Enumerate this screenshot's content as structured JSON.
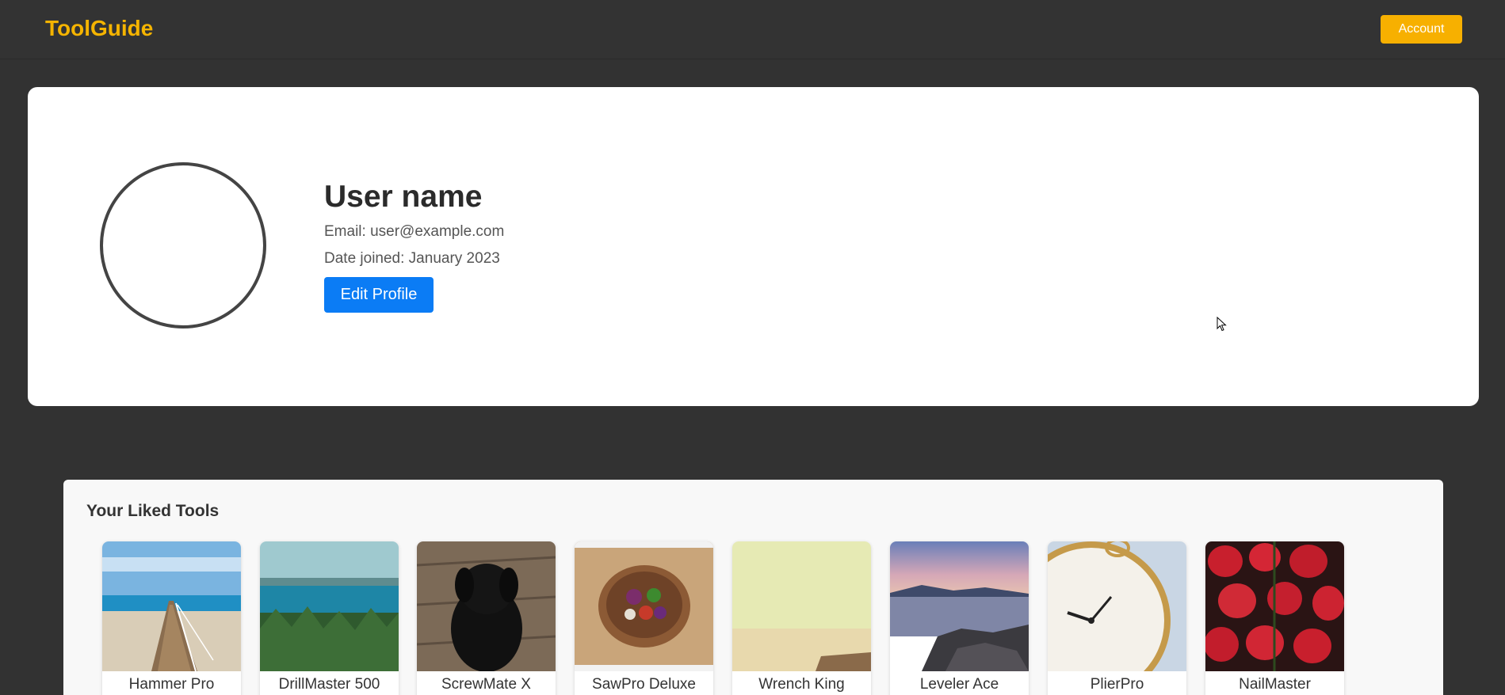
{
  "header": {
    "brand": "ToolGuide",
    "account_label": "Account"
  },
  "profile": {
    "name": "User name",
    "email_line": "Email: user@example.com",
    "date_line": "Date joined: January 2023",
    "edit_label": "Edit Profile"
  },
  "liked": {
    "title": "Your Liked Tools",
    "tools": [
      {
        "name": "Hammer Pro",
        "image": "pier-over-beach-photo"
      },
      {
        "name": "DrillMaster 500",
        "image": "lake-and-forest-photo"
      },
      {
        "name": "ScrewMate X",
        "image": "black-puppy-photo"
      },
      {
        "name": "SawPro Deluxe",
        "image": "salad-bowl-photo"
      },
      {
        "name": "Wrench King",
        "image": "hazy-landscape-photo"
      },
      {
        "name": "Leveler Ace",
        "image": "rocky-shore-sunset-photo"
      },
      {
        "name": "PlierPro",
        "image": "pocket-watch-photo"
      },
      {
        "name": "NailMaster",
        "image": "strawberries-photo"
      }
    ]
  }
}
